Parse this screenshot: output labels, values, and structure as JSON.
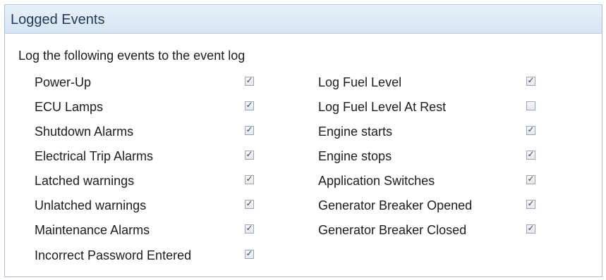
{
  "panel": {
    "title": "Logged Events"
  },
  "group": {
    "label": "Log the following events to the event log"
  },
  "events": {
    "left": [
      {
        "label": "Power-Up",
        "checked": true
      },
      {
        "label": "ECU Lamps",
        "checked": true
      },
      {
        "label": "Shutdown Alarms",
        "checked": true
      },
      {
        "label": "Electrical Trip Alarms",
        "checked": true
      },
      {
        "label": "Latched warnings",
        "checked": true
      },
      {
        "label": "Unlatched warnings",
        "checked": true
      },
      {
        "label": "Maintenance Alarms",
        "checked": true
      },
      {
        "label": "Incorrect Password Entered",
        "checked": true
      }
    ],
    "right": [
      {
        "label": "Log Fuel Level",
        "checked": true
      },
      {
        "label": "Log Fuel Level At Rest",
        "checked": false
      },
      {
        "label": "Engine starts",
        "checked": true
      },
      {
        "label": "Engine stops",
        "checked": true
      },
      {
        "label": "Application Switches",
        "checked": true
      },
      {
        "label": "Generator Breaker Opened",
        "checked": true
      },
      {
        "label": "Generator Breaker Closed",
        "checked": true
      }
    ]
  },
  "icons": {
    "checkbox_checked": "checkmark-icon"
  },
  "colors": {
    "header_bg": "#dde8f5",
    "header_text": "#1e3a5c",
    "border": "#a9bfd6"
  }
}
